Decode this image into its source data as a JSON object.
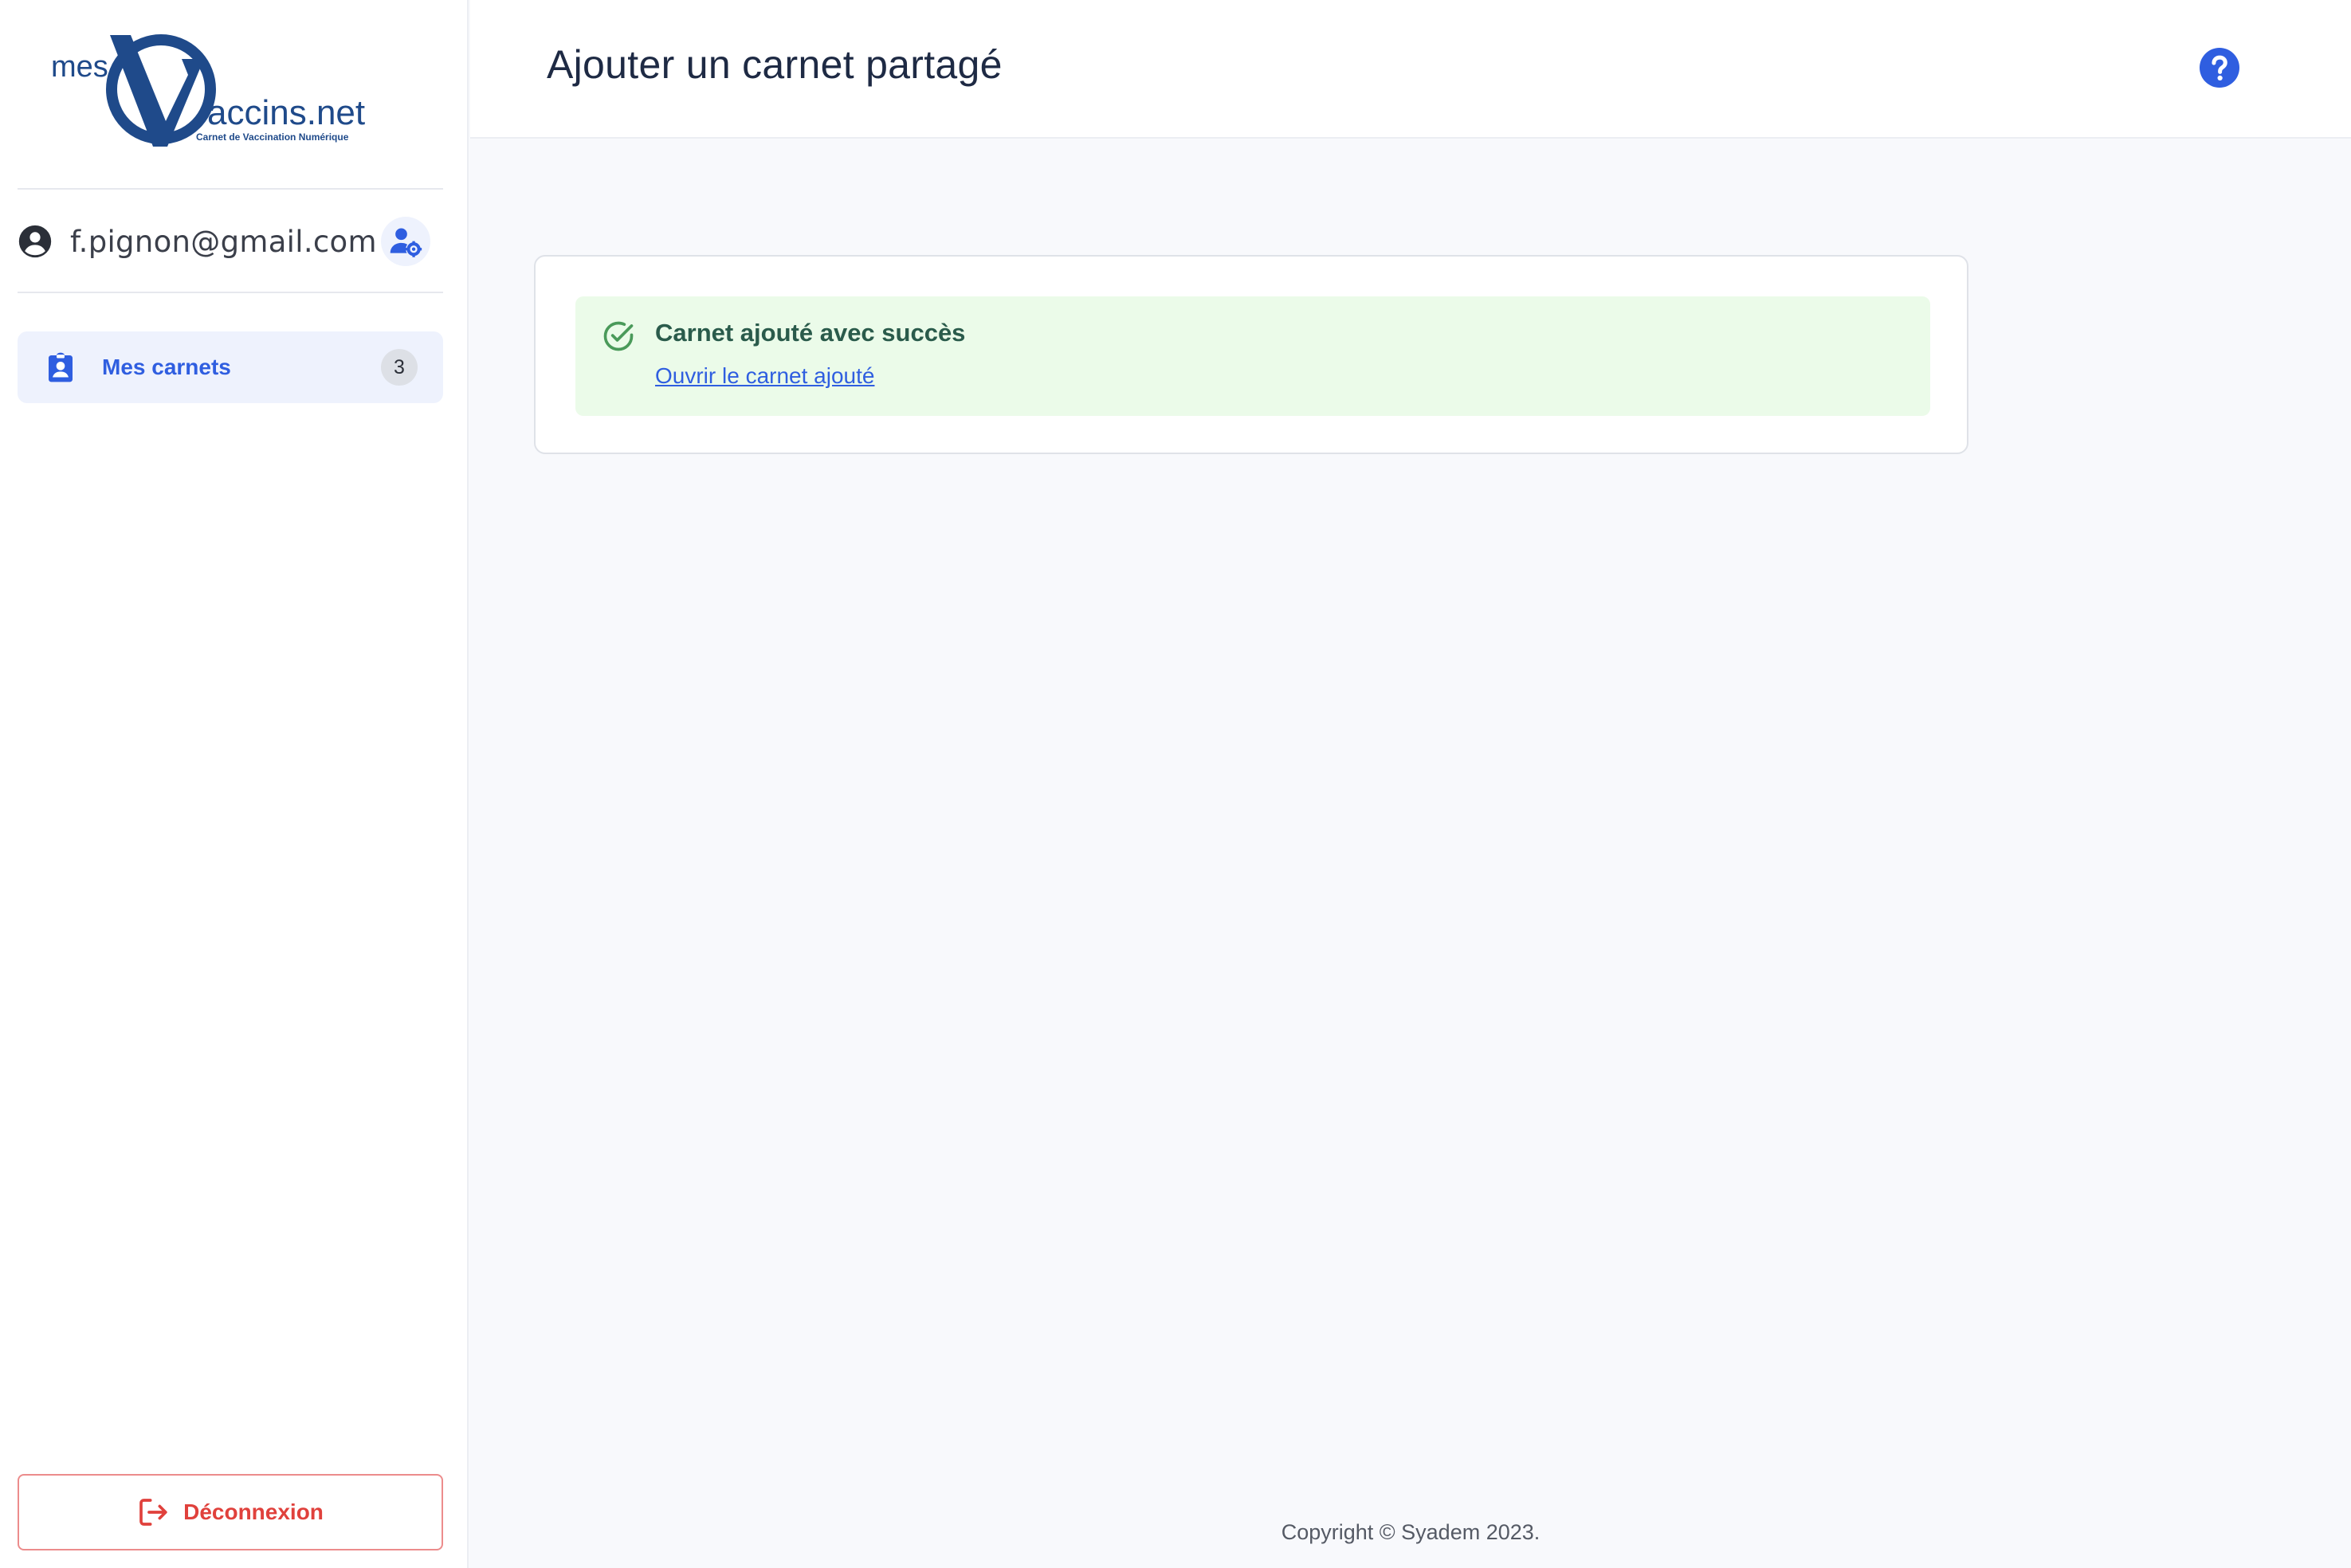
{
  "app": {
    "logo_prefix": "mes",
    "logo_main": "accins.net",
    "logo_tagline": "Carnet de Vaccination Numérique"
  },
  "sidebar": {
    "user_email": "f.pignon@gmail.com",
    "user_icon": "user-circle-icon",
    "settings_icon": "user-cog-icon",
    "nav_items": [
      {
        "label": "Mes carnets",
        "count": "3",
        "icon": "clipboard-user-icon",
        "active": true
      }
    ],
    "logout_label": "Déconnexion",
    "logout_icon": "logout-icon"
  },
  "header": {
    "title": "Ajouter un carnet partagé",
    "help_icon": "question-circle-icon"
  },
  "alert": {
    "title": "Carnet ajouté avec succès",
    "link_label": "Ouvrir le carnet ajouté",
    "icon": "check-circle-icon"
  },
  "footer": {
    "copyright": "Copyright © Syadem 2023."
  },
  "colors": {
    "primary": "#2f5ee0",
    "logo": "#1f4a8a",
    "success_bg": "#ebfbe9",
    "success_text": "#2a5b4b",
    "danger": "#e0413c"
  }
}
